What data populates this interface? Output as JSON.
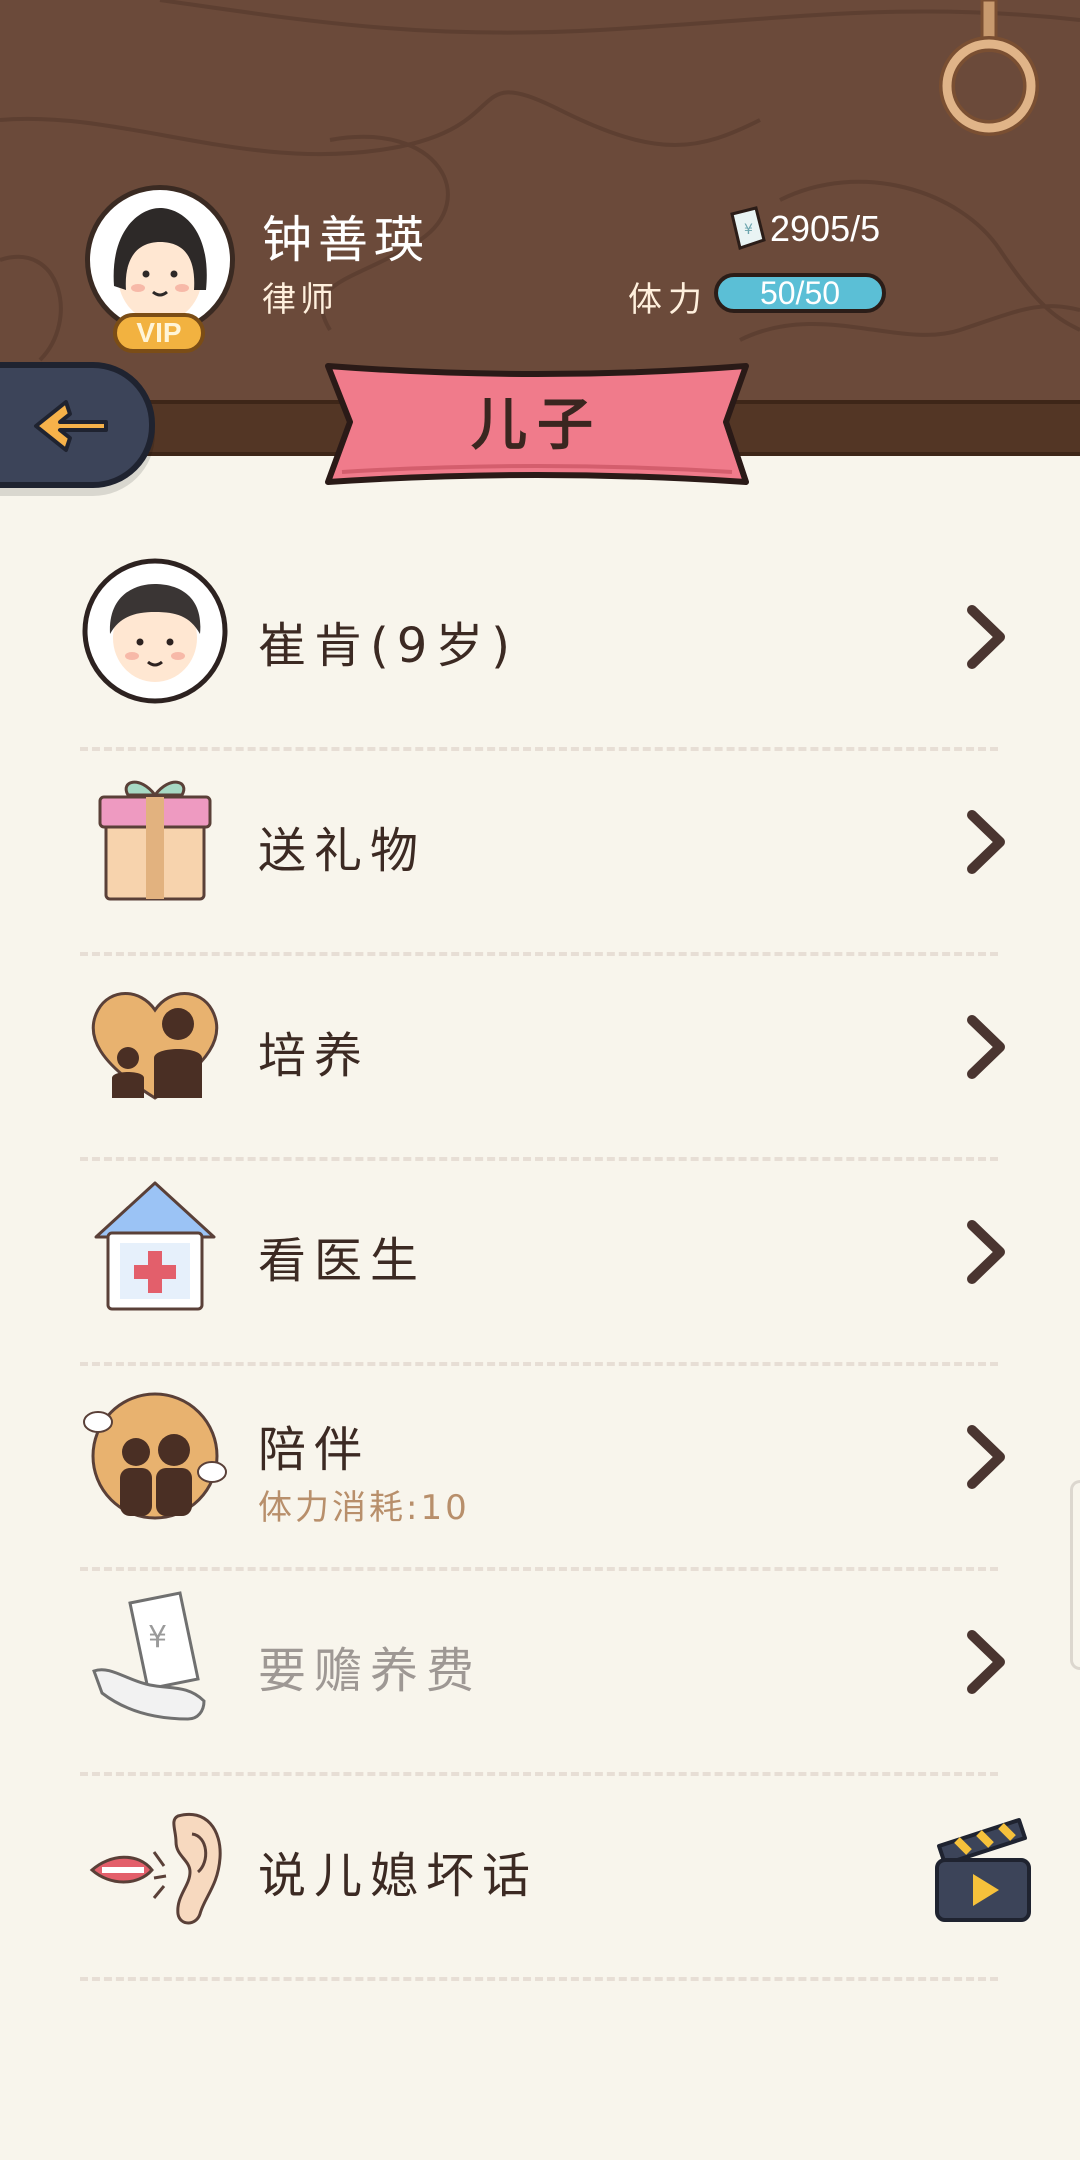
{
  "header": {
    "player_name": "钟善瑛",
    "player_job": "律师",
    "vip_label": "VIP",
    "money_value": "2905/5",
    "stamina_label": "体力",
    "stamina_value": "50/50",
    "title": "儿子"
  },
  "icons": {
    "back": "arrow-left-icon",
    "hook": "ring-hook-icon",
    "money": "banknote-icon"
  },
  "menu": {
    "items": [
      {
        "label": "崔肯(9岁)",
        "icon": "child-avatar-icon"
      },
      {
        "label": "送礼物",
        "icon": "gift-icon"
      },
      {
        "label": "培养",
        "icon": "parent-child-heart-icon"
      },
      {
        "label": "看医生",
        "icon": "hospital-icon"
      },
      {
        "label": "陪伴",
        "sublabel": "体力消耗:10",
        "icon": "family-icon"
      },
      {
        "label": "要赡养费",
        "icon": "money-hand-icon",
        "disabled": true
      },
      {
        "label": "说儿媳坏话",
        "icon": "mouth-ear-icon",
        "action_icon": "video-play-icon"
      }
    ]
  },
  "colors": {
    "wood": "#6b4a3a",
    "ribbon": "#f07b8b",
    "stamina": "#5bbfd6",
    "background": "#f8f5ec"
  }
}
